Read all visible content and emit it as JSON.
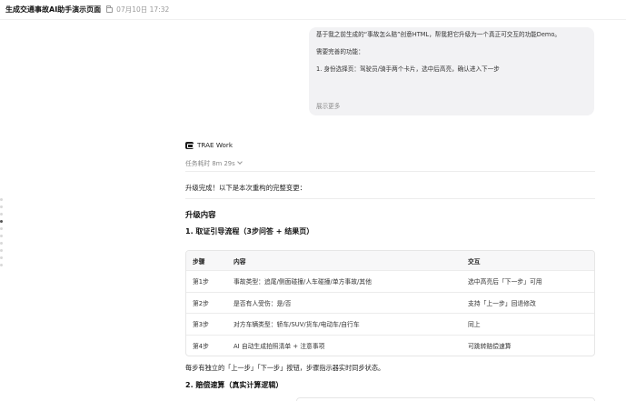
{
  "topbar": {
    "title": "生成交通事故AI助手演示页面",
    "date": "07月10日 17:32"
  },
  "user_message": {
    "lines": [
      "基于我之前生成的“事故怎么赔”创意HTML，帮我把它升级为一个真正可交互的功能Demo。",
      "需要完善的功能：",
      "1. 身份选择页：驾驶员/骑手两个卡片，选中后高亮，确认进入下一步"
    ],
    "show_more": "展示更多"
  },
  "assistant": {
    "brand": "TRAE Work",
    "task_time": "任务耗时 8m 29s",
    "intro": "升级完成！以下是本次重构的完整变更：",
    "section_title": "升级内容",
    "sub1": "1. 取证引导流程（3步问答 + 结果页）",
    "table": {
      "headers": [
        "步骤",
        "内容",
        "交互"
      ],
      "rows": [
        [
          "第1步",
          "事故类型：追尾/侧面碰撞/人车碰撞/单方事故/其他",
          "选中高亮后「下一步」可用"
        ],
        [
          "第2步",
          "是否有人受伤：是/否",
          "支持「上一步」回退修改"
        ],
        [
          "第3步",
          "对方车辆类型：轿车/SUV/货车/电动车/自行车",
          "同上"
        ],
        [
          "第4步",
          "AI 自动生成拍照清单 + 注意事项",
          "可跳转赔偿速算"
        ]
      ]
    },
    "note": "每步有独立的「上一步」「下一步」按钮，步骤指示器实时同步状态。",
    "sub2": "2. 赔偿速算（真实计算逻辑）"
  }
}
